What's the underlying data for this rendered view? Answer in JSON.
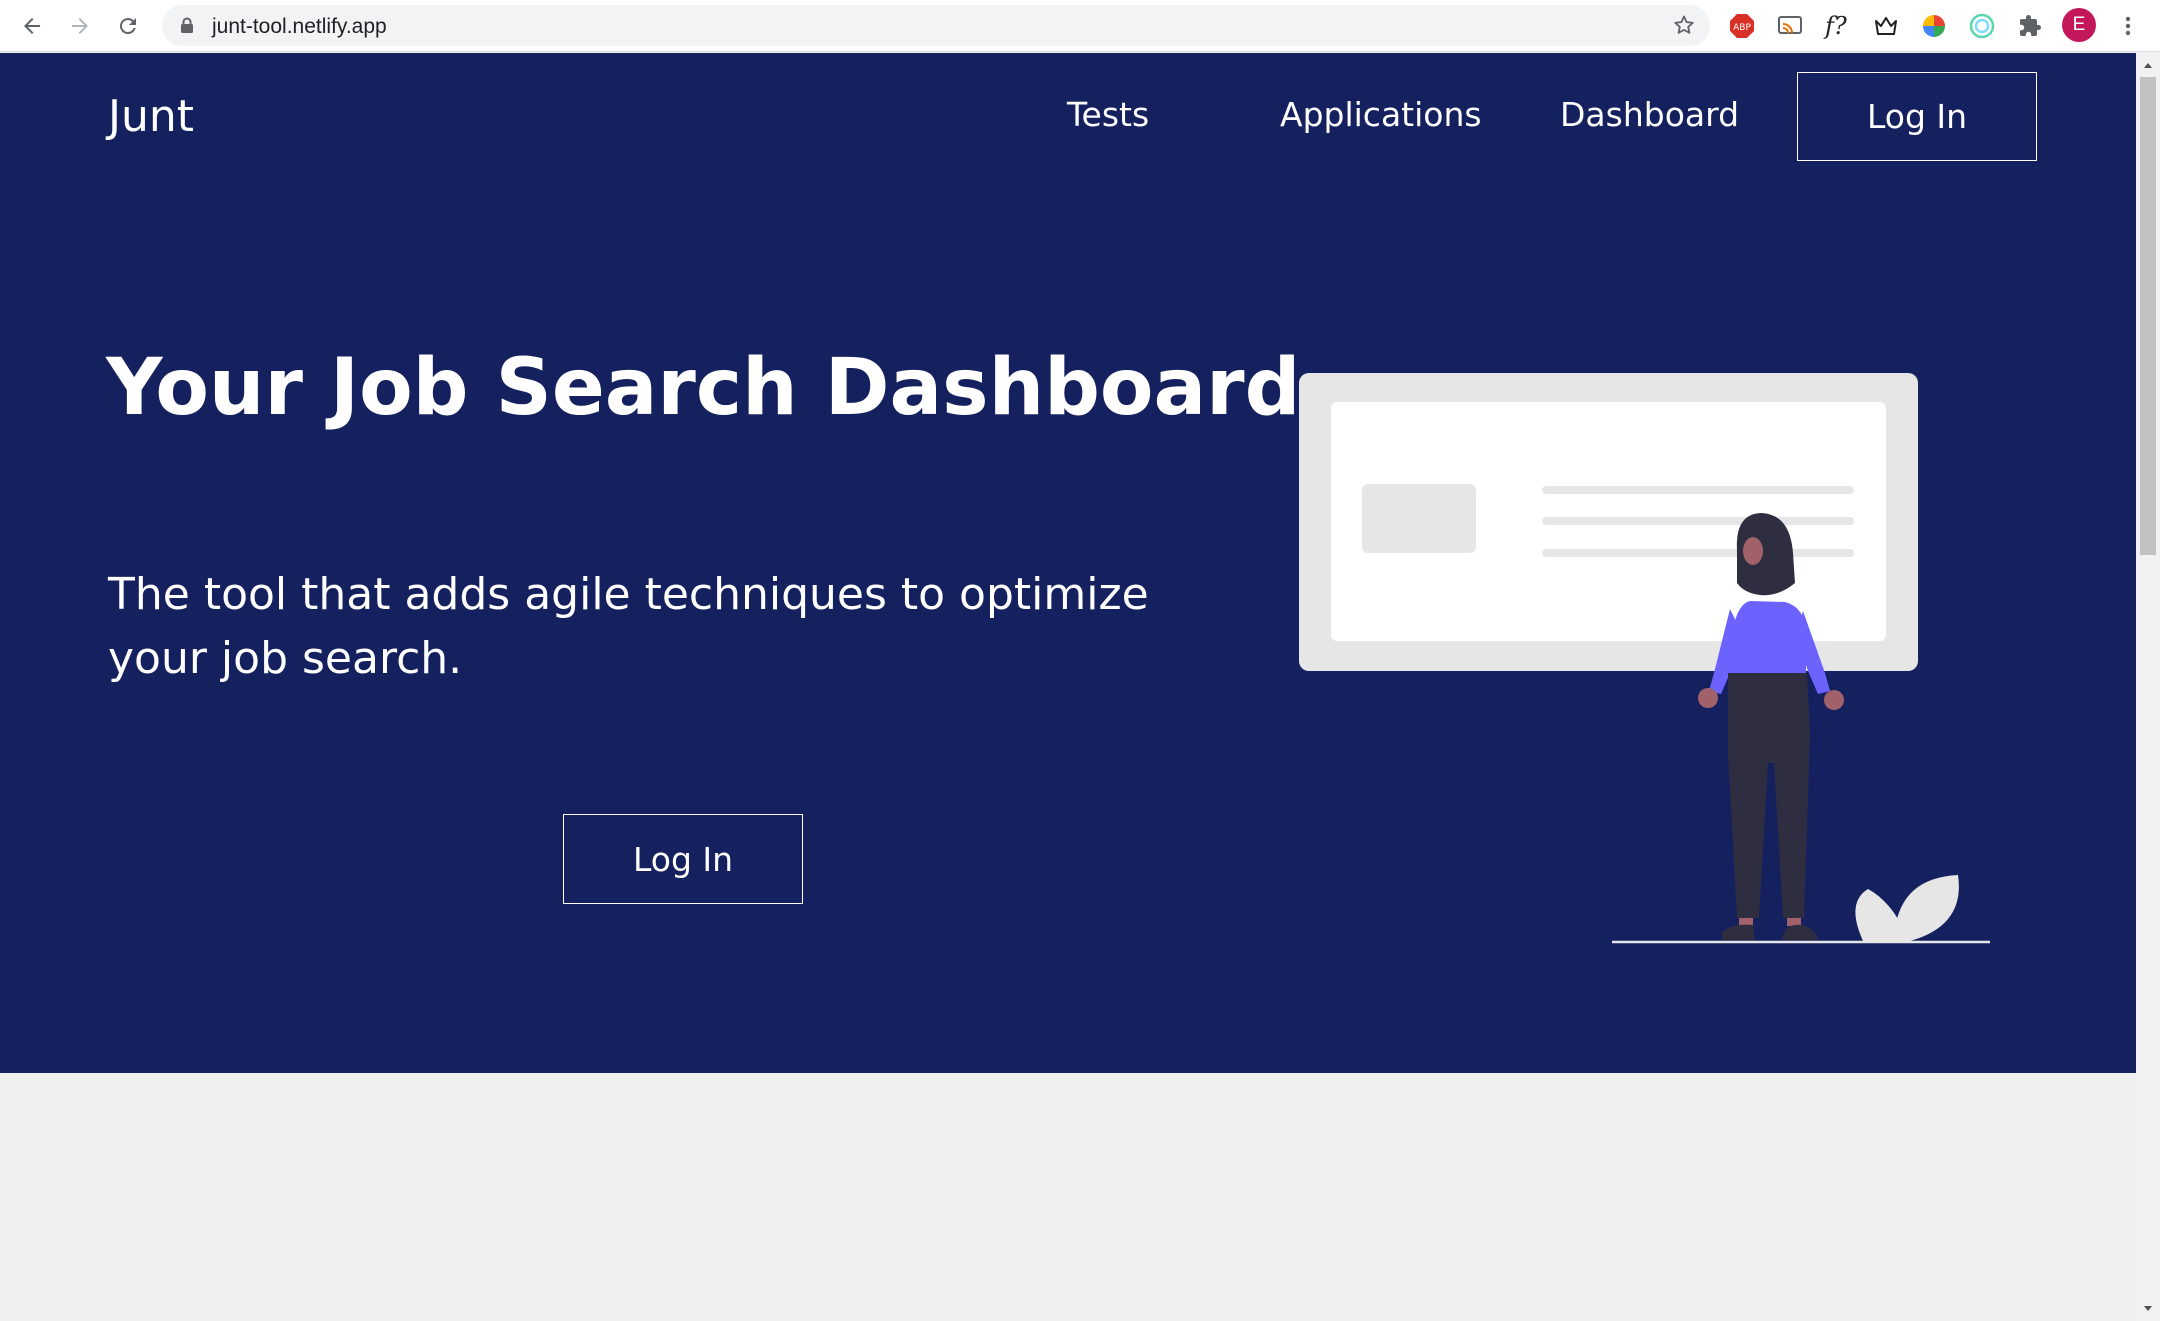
{
  "browser": {
    "url": "junt-tool.netlify.app",
    "profile_initial": "E",
    "icons": [
      "back-icon",
      "forward-icon",
      "reload-icon",
      "lock-icon",
      "star-icon",
      "adblock-icon",
      "cast-icon",
      "font-identifier-icon",
      "crown-icon",
      "color-picker-icon",
      "target-icon",
      "extensions-icon",
      "menu-icon"
    ]
  },
  "header": {
    "brand": "Junt",
    "nav": [
      "Tests",
      "Applications",
      "Dashboard"
    ],
    "login_label": "Log In"
  },
  "hero": {
    "title": "Your Job Search Dashboard",
    "subtitle": "The tool that adds agile techniques to optimize your job search.",
    "cta_label": "Log In"
  },
  "colors": {
    "hero_bg": "#15215e",
    "page_bg": "#efefef",
    "accent": "#6c63ff",
    "text": "#ffffff"
  }
}
